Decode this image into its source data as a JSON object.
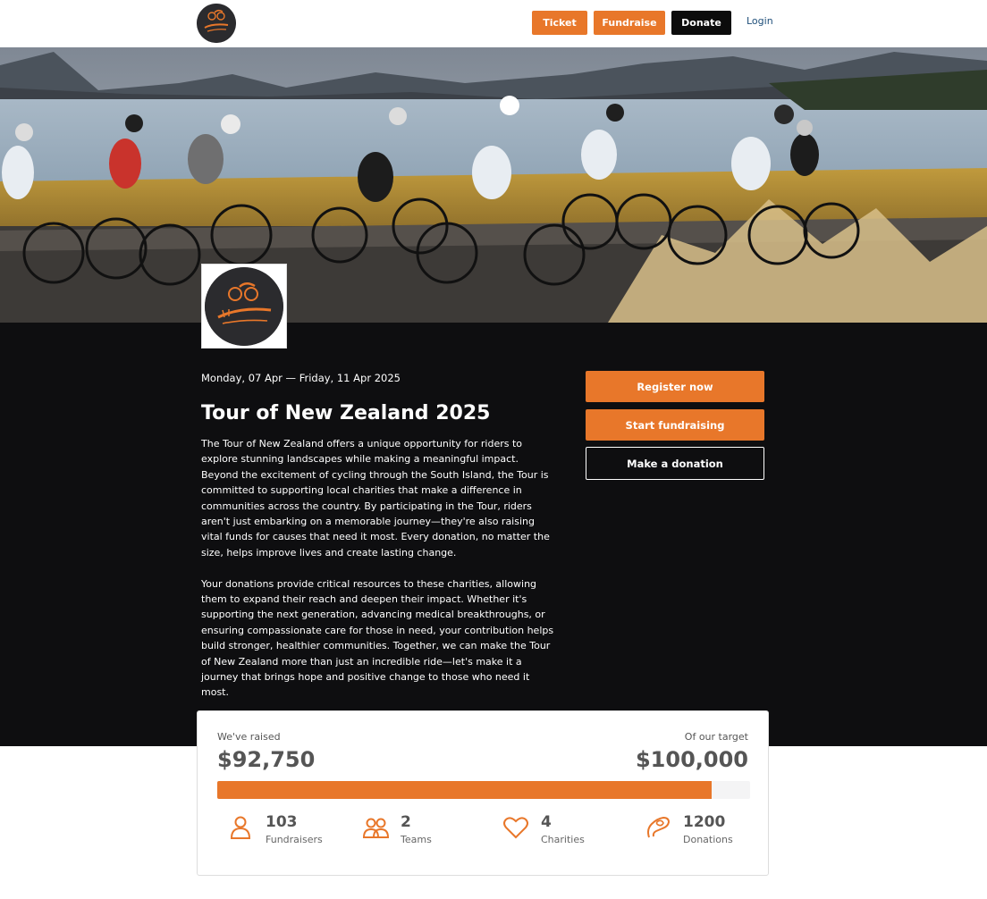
{
  "header": {
    "logo_icon": "tour-of-new-zealand-logo",
    "buttons": {
      "ticket": "Ticket",
      "fundraise": "Fundraise",
      "donate": "Donate"
    },
    "login": "Login"
  },
  "event": {
    "date": "Monday, 07 Apr — Friday, 11 Apr 2025",
    "title": "Tour of New Zealand 2025",
    "description": [
      "The Tour of New Zealand offers a unique opportunity for riders to explore stunning landscapes while making a meaningful impact. Beyond the excitement of cycling through the South Island, the Tour is committed to supporting local charities that make a difference in communities across the country. By participating in the Tour, riders aren't just embarking on a memorable journey—they're also raising vital funds for causes that need it most. Every donation, no matter the size, helps improve lives and create lasting change.",
      "Your donations provide critical resources to these charities, allowing them to expand their reach and deepen their impact. Whether it's supporting the next generation, advancing medical breakthroughs, or ensuring compassionate care for those in need, your contribution helps build stronger, healthier communities. Together, we can make the Tour of New Zealand more than just an incredible ride—let's make it a journey that brings hope and positive change to those who need it most."
    ]
  },
  "actions": {
    "register": "Register now",
    "start_fundraising": "Start fundraising",
    "make_donation": "Make a donation"
  },
  "stats": {
    "raised_label": "We've raised",
    "raised_value": "$92,750",
    "target_label": "Of our target",
    "target_value": "$100,000",
    "progress_fraction": 0.9275,
    "items": [
      {
        "icon": "person-icon",
        "value": "103",
        "label": "Fundraisers"
      },
      {
        "icon": "people-icon",
        "value": "2",
        "label": "Teams"
      },
      {
        "icon": "heart-icon",
        "value": "4",
        "label": "Charities"
      },
      {
        "icon": "donation-hand-icon",
        "value": "1200",
        "label": "Donations"
      }
    ]
  },
  "colors": {
    "accent": "#e8772a",
    "dark": "#0e0e10",
    "logo_bg": "#2b2b2e"
  }
}
